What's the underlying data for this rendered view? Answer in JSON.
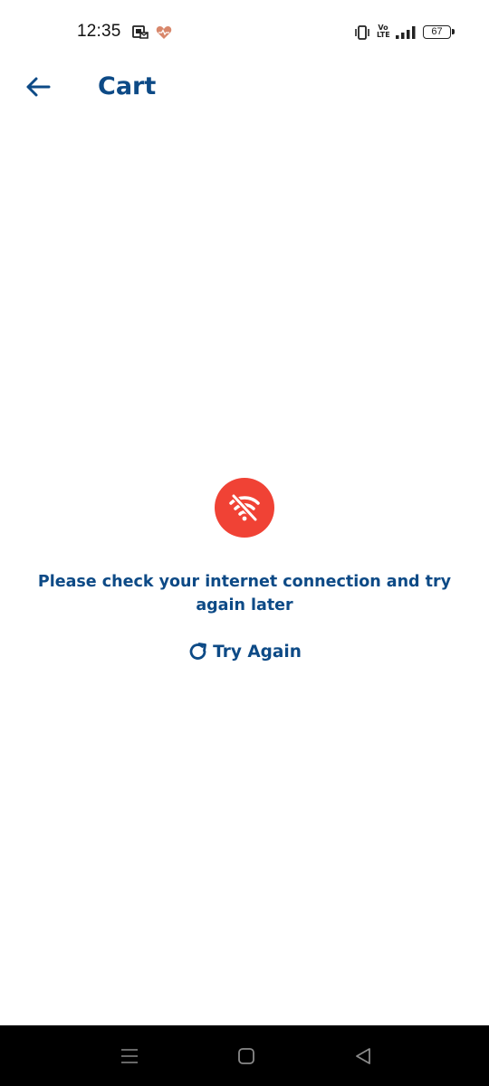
{
  "status_bar": {
    "time": "12:35",
    "battery": "67",
    "network_label_top": "Vo",
    "network_label_bottom": "LTE",
    "icons": [
      "notification-mail-icon",
      "health-heart-icon",
      "vibrate-icon",
      "volte-icon",
      "signal-icon",
      "battery-icon"
    ]
  },
  "header": {
    "title": "Cart",
    "back_icon": "arrow-left-icon"
  },
  "error": {
    "icon": "wifi-off-icon",
    "message": "Please check your internet connection and try again later",
    "retry_label": "Try Again",
    "retry_icon": "refresh-icon"
  },
  "nav_bar": {
    "icons": [
      "menu-lines-icon",
      "home-square-icon",
      "back-triangle-icon"
    ]
  },
  "colors": {
    "primary": "#0d4a86",
    "error_icon_bg": "#f04235",
    "background": "#ffffff",
    "nav_bar": "#000000",
    "heart_icon": "#d8876b"
  }
}
